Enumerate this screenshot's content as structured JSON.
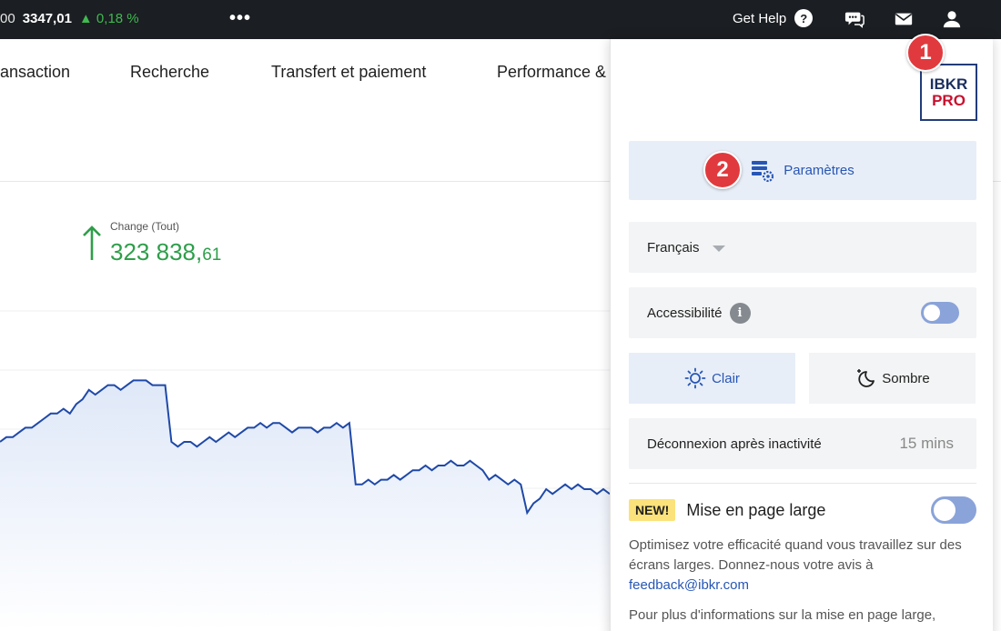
{
  "topbar": {
    "ticker_lead": "00",
    "ticker_value": "3347,01",
    "ticker_change": "▲ 0,18 %",
    "more_label": "•••",
    "help_label": "Get Help",
    "help_glyph": "?",
    "icons": [
      "chat-icon",
      "mail-icon",
      "user-icon"
    ]
  },
  "nav": {
    "items": [
      "ansaction",
      "Recherche",
      "Transfert et paiement",
      "Performance &"
    ]
  },
  "summary": {
    "change_label": "Change (Tout)",
    "change_int": "323 838,",
    "change_dec": "61",
    "color": "#2e9e4a"
  },
  "panel": {
    "logo_line1": "IBKR",
    "logo_line2": "PRO",
    "settings_label": "Paramètres",
    "language": "Français",
    "accessibility_label": "Accessibilité",
    "info_glyph": "i",
    "accessibility_on": false,
    "theme_light": "Clair",
    "theme_dark": "Sombre",
    "theme_selected": "light",
    "logout_label": "Déconnexion après inactivité",
    "logout_value": "15 mins",
    "new_badge": "NEW!",
    "wide_layout_label": "Mise en page large",
    "wide_layout_on": false,
    "desc_text": "Optimisez votre efficacité quand vous travaillez sur des écrans larges. Donnez-nous votre avis à ",
    "desc_link": "feedback@ibkr.com",
    "more_info": "Pour plus d'informations sur la mise en page large,"
  },
  "steps": [
    "1",
    "2"
  ],
  "colors": {
    "accent": "#2756b5",
    "topbar": "#1b1e22",
    "step_badge": "#e03a3e",
    "chart_line": "#1f49a8"
  },
  "chart_data": {
    "type": "area",
    "values": [
      100,
      101,
      101,
      102,
      103,
      103,
      104,
      105,
      106,
      106,
      107,
      106,
      108,
      109,
      111,
      110,
      111,
      112,
      112,
      111,
      112,
      113,
      113,
      113,
      112,
      112,
      112,
      100,
      99,
      100,
      100,
      99,
      100,
      101,
      100,
      101,
      102,
      101,
      102,
      103,
      103,
      104,
      103,
      104,
      104,
      103,
      102,
      103,
      103,
      103,
      102,
      103,
      103,
      104,
      103,
      104,
      91,
      91,
      92,
      91,
      92,
      92,
      93,
      92,
      93,
      94,
      94,
      95,
      94,
      95,
      95,
      96,
      95,
      95,
      96,
      95,
      94,
      92,
      93,
      92,
      91,
      92,
      91,
      85,
      87,
      88,
      90,
      89,
      90,
      91,
      90,
      91,
      90,
      90,
      89,
      90,
      89
    ]
  }
}
